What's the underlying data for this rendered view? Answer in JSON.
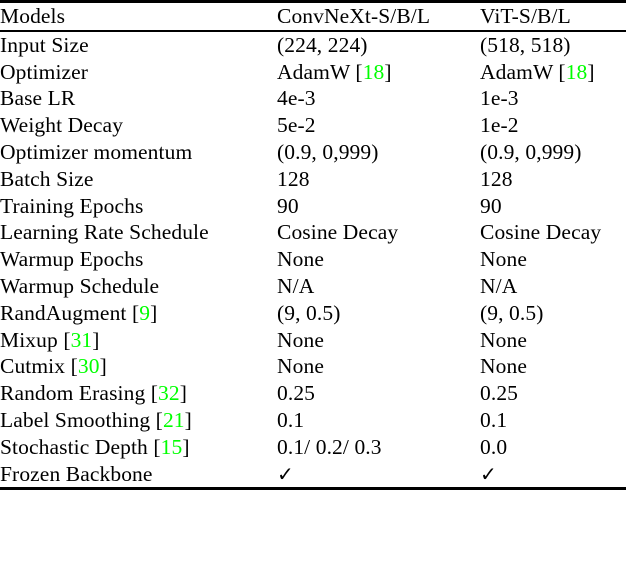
{
  "table": {
    "columns": [
      "Models",
      "ConvNeXt-S/B/L",
      "ViT-S/B/L"
    ],
    "accent_citation_color": "#00ff00",
    "rows": [
      {
        "label": "Input Size",
        "col2": "(224, 224)",
        "col3": "(518, 518)"
      },
      {
        "label": "Optimizer",
        "col2_pre": "AdamW [",
        "col2_cite": "18",
        "col2_post": "]",
        "col3_pre": "AdamW [",
        "col3_cite": "18",
        "col3_post": "]"
      },
      {
        "label": "Base LR",
        "col2": "4e-3",
        "col3": "1e-3"
      },
      {
        "label": "Weight Decay",
        "col2": "5e-2",
        "col3": "1e-2"
      },
      {
        "label": "Optimizer momentum",
        "col2": "(0.9, 0,999)",
        "col3": "(0.9, 0,999)"
      },
      {
        "label": "Batch Size",
        "col2": "128",
        "col3": "128"
      },
      {
        "label": "Training Epochs",
        "col2": "90",
        "col3": "90"
      },
      {
        "label": "Learning Rate Schedule",
        "col2": "Cosine Decay",
        "col3": "Cosine Decay"
      },
      {
        "label": "Warmup Epochs",
        "col2": "None",
        "col3": "None"
      },
      {
        "label": "Warmup Schedule",
        "col2": "N/A",
        "col3": "N/A"
      },
      {
        "label_pre": "RandAugment [",
        "label_cite": "9",
        "label_post": "]",
        "col2": "(9, 0.5)",
        "col3": "(9, 0.5)"
      },
      {
        "label_pre": "Mixup [",
        "label_cite": "31",
        "label_post": "]",
        "col2": "None",
        "col3": "None"
      },
      {
        "label_pre": "Cutmix [",
        "label_cite": "30",
        "label_post": "]",
        "col2": "None",
        "col3": "None"
      },
      {
        "label_pre": "Random Erasing [",
        "label_cite": "32",
        "label_post": "]",
        "col2": "0.25",
        "col3": "0.25"
      },
      {
        "label_pre": "Label Smoothing [",
        "label_cite": "21",
        "label_post": "]",
        "col2": "0.1",
        "col3": "0.1"
      },
      {
        "label_pre": "Stochastic Depth [",
        "label_cite": "15",
        "label_post": "]",
        "col2": "0.1/ 0.2/ 0.3",
        "col3": "0.0"
      },
      {
        "label": "Frozen Backbone",
        "col2": "✓",
        "col3": "✓"
      }
    ]
  }
}
